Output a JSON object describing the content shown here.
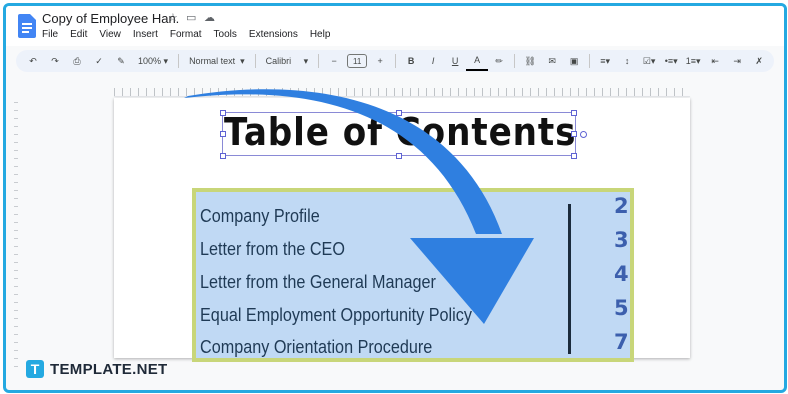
{
  "document": {
    "title": "Copy of Employee Han."
  },
  "menu": [
    "File",
    "Edit",
    "View",
    "Insert",
    "Format",
    "Tools",
    "Extensions",
    "Help"
  ],
  "toolbar": {
    "zoom": "100%",
    "style": "Normal text",
    "font": "Calibri",
    "font_size": "11",
    "minus": "−",
    "plus": "+",
    "bold": "B",
    "italic": "I",
    "underline": "U",
    "text_color": "A"
  },
  "content": {
    "heading": "Table of Contents",
    "toc": [
      {
        "label": "Company Profile",
        "page": "2"
      },
      {
        "label": "Letter from the CEO",
        "page": "3"
      },
      {
        "label": "Letter from the General Manager",
        "page": "4"
      },
      {
        "label": "Equal Employment Opportunity Policy",
        "page": "5"
      },
      {
        "label": "Company Orientation Procedure",
        "page": "7"
      }
    ]
  },
  "brand": {
    "logo_letter": "T",
    "name": "TEMPLATE.NET"
  },
  "colors": {
    "frame": "#24a9e1",
    "toc_bg": "#c0d9f4",
    "toc_border": "#c8d679",
    "arrow": "#2f7fe0"
  }
}
